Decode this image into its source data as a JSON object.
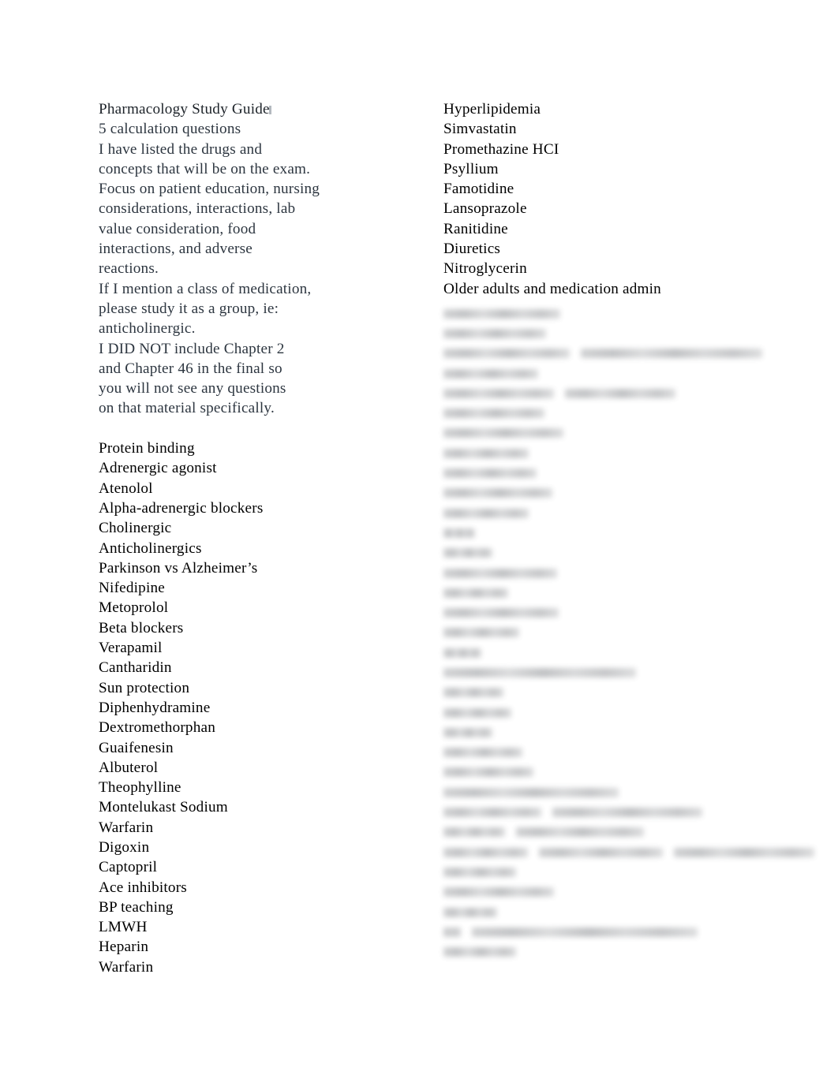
{
  "document": {
    "title": "Pharmacology Study Guide",
    "background_color": "#ffffff",
    "intro_text_color": "#2d3640",
    "list_text_color": "#000000"
  },
  "left_column": {
    "intro": [
      "Pharmacology Study Guide",
      "5 calculation questions",
      "I have listed the drugs and",
      "concepts that will be on the exam.",
      "Focus on patient education, nursing",
      "considerations, interactions, lab",
      "value consideration, food",
      "interactions, and adverse",
      "reactions.",
      "If I mention a class of medication,",
      "please study it as a group, ie:",
      "anticholinergic.",
      "I DID NOT include Chapter 2",
      "and Chapter 46 in the final so",
      "you will not see any questions",
      "on that material specifically."
    ],
    "items": [
      "Protein binding",
      "Adrenergic agonist",
      "Atenolol",
      "Alpha-adrenergic blockers",
      "Cholinergic",
      "Anticholinergics",
      "Parkinson vs Alzheimer’s",
      "Nifedipine",
      "Metoprolol",
      "Beta blockers",
      "Verapamil",
      "Cantharidin",
      "Sun protection",
      "Diphenhydramine",
      "Dextromethorphan",
      "Guaifenesin",
      "Albuterol",
      "Theophylline",
      "Montelukast Sodium",
      "Warfarin",
      "Digoxin",
      "Captopril",
      "Ace inhibitors",
      "BP teaching",
      "LMWH",
      "Heparin",
      "Warfarin"
    ]
  },
  "right_column": {
    "items": [
      "Hyperlipidemia",
      "Simvastatin",
      "Promethazine HCI",
      "Psyllium",
      "Famotidine",
      "Lansoprazole",
      "Ranitidine",
      "Diuretics",
      "Nitroglycerin",
      "Older adults and medication admin"
    ],
    "obscured_block": {
      "note": "Remaining right-column lines are blurred beyond legibility in the source image; only line extents are reproduced.",
      "line_widths": [
        [
          148
        ],
        [
          130
        ],
        [
          160,
          230
        ],
        [
          120
        ],
        [
          140,
          140
        ],
        [
          128
        ],
        [
          152
        ],
        [
          108
        ],
        [
          118
        ],
        [
          138
        ],
        [
          108
        ],
        [
          40
        ],
        [
          62
        ],
        [
          144
        ],
        [
          82
        ],
        [
          146
        ],
        [
          96
        ],
        [
          48
        ],
        [
          244
        ],
        [
          76
        ],
        [
          86
        ],
        [
          62
        ],
        [
          100
        ],
        [
          114
        ],
        [
          222
        ],
        [
          124,
          190
        ],
        [
          78,
          162
        ],
        [
          108,
          160,
          180
        ],
        [
          92
        ],
        [
          140
        ],
        [
          68
        ],
        [
          22,
          286
        ],
        [
          92
        ]
      ]
    }
  }
}
